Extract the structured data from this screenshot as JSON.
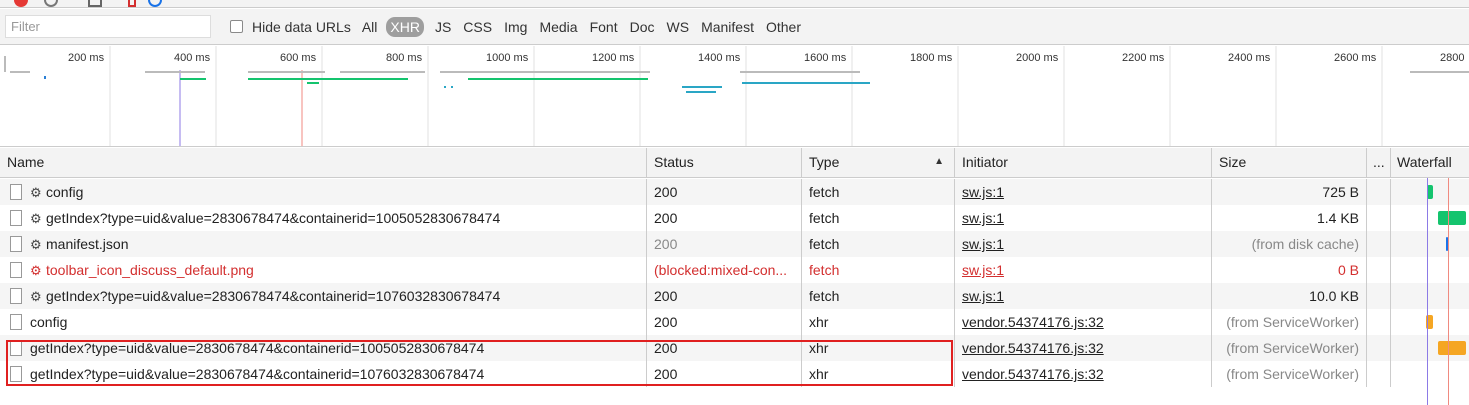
{
  "filter": {
    "placeholder": "Filter"
  },
  "hide_data_urls_label": "Hide data URLs",
  "types": [
    "All",
    "XHR",
    "JS",
    "CSS",
    "Img",
    "Media",
    "Font",
    "Doc",
    "WS",
    "Manifest",
    "Other"
  ],
  "active_type": "XHR",
  "overview": {
    "ticks": [
      "200 ms",
      "400 ms",
      "600 ms",
      "800 ms",
      "1000 ms",
      "1200 ms",
      "1400 ms",
      "1600 ms",
      "1800 ms",
      "2000 ms",
      "2200 ms",
      "2400 ms",
      "2600 ms",
      "2800"
    ]
  },
  "columns": {
    "name": "Name",
    "status": "Status",
    "type": "Type",
    "initiator": "Initiator",
    "size": "Size",
    "more": "...",
    "waterfall": "Waterfall"
  },
  "sorted_by": "type",
  "rows": [
    {
      "name": "config",
      "sw": true,
      "status": "200",
      "type": "fetch",
      "initiator": "sw.js:1",
      "size": "725 B",
      "color": "normal"
    },
    {
      "name": "getIndex?type=uid&value=2830678474&containerid=1005052830678474",
      "sw": true,
      "status": "200",
      "type": "fetch",
      "initiator": "sw.js:1",
      "size": "1.4 KB",
      "color": "normal"
    },
    {
      "name": "manifest.json",
      "sw": true,
      "status": "200",
      "type": "fetch",
      "initiator": "sw.js:1",
      "size": "(from disk cache)",
      "color": "muted"
    },
    {
      "name": "toolbar_icon_discuss_default.png",
      "sw": true,
      "status": "(blocked:mixed-con...",
      "type": "fetch",
      "initiator": "sw.js:1",
      "size": "0 B",
      "color": "red"
    },
    {
      "name": "getIndex?type=uid&value=2830678474&containerid=1076032830678474",
      "sw": true,
      "status": "200",
      "type": "fetch",
      "initiator": "sw.js:1",
      "size": "10.0 KB",
      "color": "normal"
    },
    {
      "name": "config",
      "sw": false,
      "status": "200",
      "type": "xhr",
      "initiator": "vendor.54374176.js:32",
      "size": "(from ServiceWorker)",
      "color": "normal"
    },
    {
      "name": "getIndex?type=uid&value=2830678474&containerid=1005052830678474",
      "sw": false,
      "status": "200",
      "type": "xhr",
      "initiator": "vendor.54374176.js:32",
      "size": "(from ServiceWorker)",
      "color": "normal"
    },
    {
      "name": "getIndex?type=uid&value=2830678474&containerid=1076032830678474",
      "sw": false,
      "status": "200",
      "type": "xhr",
      "initiator": "vendor.54374176.js:32",
      "size": "(from ServiceWorker)",
      "color": "normal"
    }
  ],
  "colors": {
    "fetch_bar": "#14c46e",
    "xhr_bar": "#f5a623",
    "dom_line": "#8c7ae6",
    "load_line": "#f08a80",
    "blocked": "#d32f2f"
  }
}
